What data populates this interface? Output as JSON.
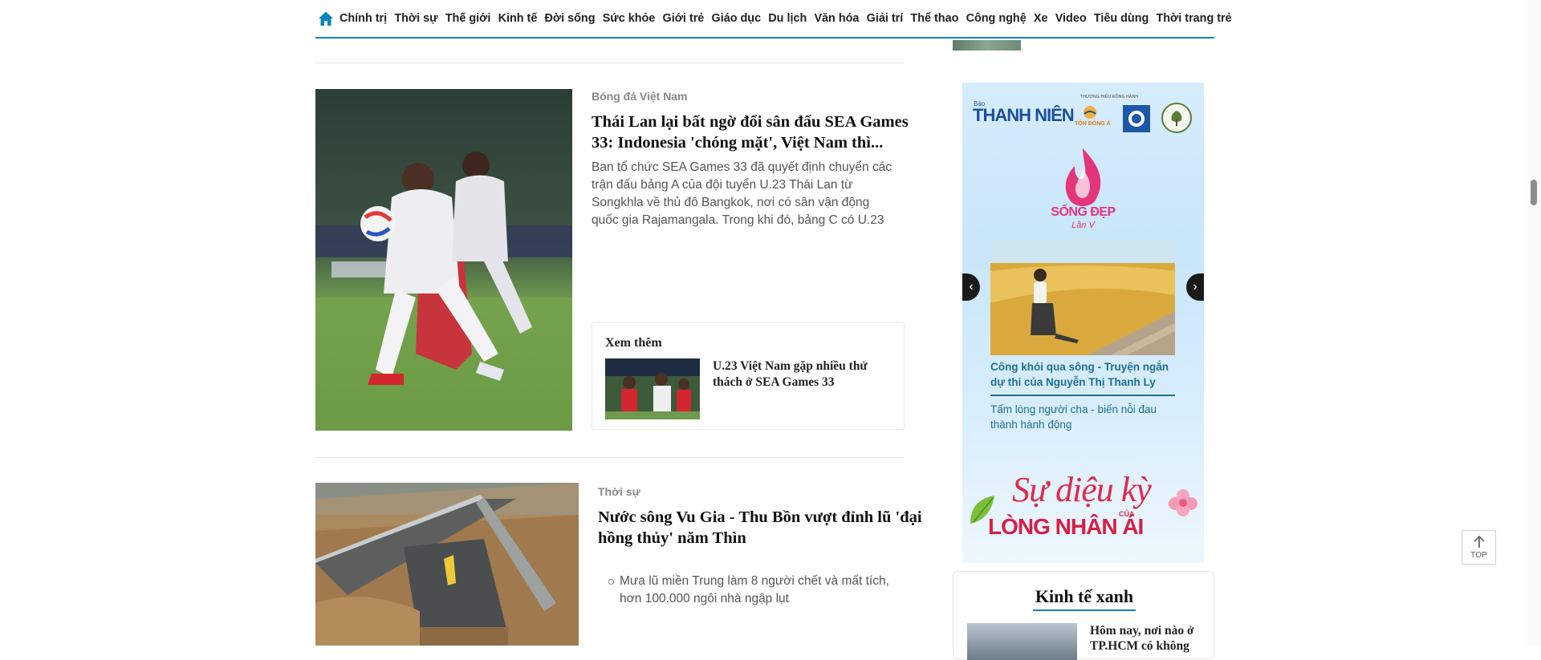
{
  "nav": {
    "items": [
      "Chính trị",
      "Thời sự",
      "Thế giới",
      "Kinh tế",
      "Đời sống",
      "Sức khỏe",
      "Giới trẻ",
      "Giáo dục",
      "Du lịch",
      "Văn hóa",
      "Giải trí",
      "Thể thao",
      "Công nghệ",
      "Xe",
      "Video",
      "Tiêu dùng",
      "Thời trang trẻ"
    ],
    "home_icon": "home-icon",
    "accent": "#0a84b9"
  },
  "article1": {
    "category": "Bóng đá Việt Nam",
    "title_line1": "Thái Lan lại bất ngờ đổi sân đấu SEA Games",
    "title_line2": "33: Indonesia 'chóng mặt', Việt Nam thì...",
    "summary": [
      "Ban tổ chức SEA Games 33 đã quyết định chuyển các",
      "trận đấu bảng A của đội tuyển U.23 Thái Lan từ",
      "Songkhla về thủ đô Bangkok, nơi có sân vận động",
      "quốc gia Rajamangala. Trong khi đó, bảng C có U.23"
    ],
    "see_more": {
      "label": "Xem thêm",
      "link_line1": "U.23 Việt Nam gặp nhiều thử",
      "link_line2": "thách ở SEA Games 33"
    }
  },
  "article2": {
    "category": "Thời sự",
    "title_line1": "Nước sông Vu Gia - Thu Bồn vượt đỉnh lũ 'đại",
    "title_line2": "hồng thủy' năm Thìn",
    "bullets": [
      [
        "Mưa lũ miền Trung làm 8 người chết và mất tích,",
        "hơn 100.000 ngôi nhà ngập lụt"
      ]
    ]
  },
  "ad": {
    "brand_small": "Báo",
    "brand": "THANH NIÊN",
    "partner_label": "THƯƠNG HIỆU ĐỒNG HÀNH",
    "partner1": "TÔN ĐÔNG Á",
    "campaign": "SỐNG ĐẸP",
    "campaign_sub": "Lần V",
    "story1_line1": "Công khói qua sông - Truyện ngắn",
    "story1_line2": "dự thi của Nguyễn Thị Thanh Ly",
    "story2_line1": "Tấm lòng người cha - biến nỗi đau",
    "story2_line2": "thành hành động",
    "slogan_1": "Sự diệu kỳ",
    "slogan_cua": "CỦA",
    "slogan_2": "LÒNG NHÂN ÁI",
    "prev": "‹",
    "next": "›"
  },
  "green_economy": {
    "title": "Kinh tế xanh",
    "link_line1": "Hôm nay, nơi nào ở",
    "link_line2": "TP.HCM có không"
  },
  "scroll_top": {
    "label": "TOP"
  }
}
